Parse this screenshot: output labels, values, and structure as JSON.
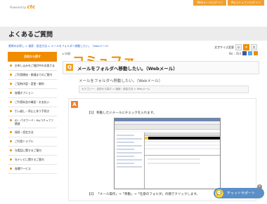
{
  "header": {
    "logo_text": "コミュファ",
    "logo_sub": "Powered by",
    "logo_brand": "ctc",
    "top_links": [
      "Webメールログイン",
      "Myコミュファログイン"
    ]
  },
  "page_title": "よくあるご質問",
  "breadcrumb": "質問のお探し > 検索・設定方法 > メールをフォルダへ移動したい。（Webメール）",
  "font_size": {
    "label": "文字サイズ変更",
    "small": "小",
    "medium": "中",
    "large": "大"
  },
  "sidebar": {
    "heading": "目的から探す",
    "items": [
      "お申し込みをご検討中のお客さま",
      "ご利用開始・開通までのご案内",
      "ご契約内容・変更・解約",
      "各種オプション",
      "ご利用料金の確認・お支払い",
      "引っ越し・停止に伴う手続き",
      "ID・パスワード・Myコミュファ関連",
      "接続・設定方法",
      "ご利用トラブル",
      "光電話に関するご案内",
      "光テレビに関するご案内",
      "各種サービス"
    ]
  },
  "main": {
    "print_label": "印刷",
    "meta_label": "No : 354",
    "question": "メールをフォルダへ移動したい。（Webメール）",
    "question_sub": "メールをフォルダへ移動したい。（Webメール）",
    "category": "カテゴリー：目的から探す > 接続・設定方法 > Webメール",
    "answer_icon": "A",
    "q_icon": "Q",
    "step1": "【1】 移動したいメールにチェックを入れます。",
    "step2": "【2】 「メール操作」→「移動」→「任意のフォルダ」の順でクリックします。"
  },
  "chat": {
    "label": "チャットサポート",
    "close": "×"
  },
  "colors": {
    "brand_orange": "#f08c00",
    "chat_blue": "#5a8fc8"
  }
}
